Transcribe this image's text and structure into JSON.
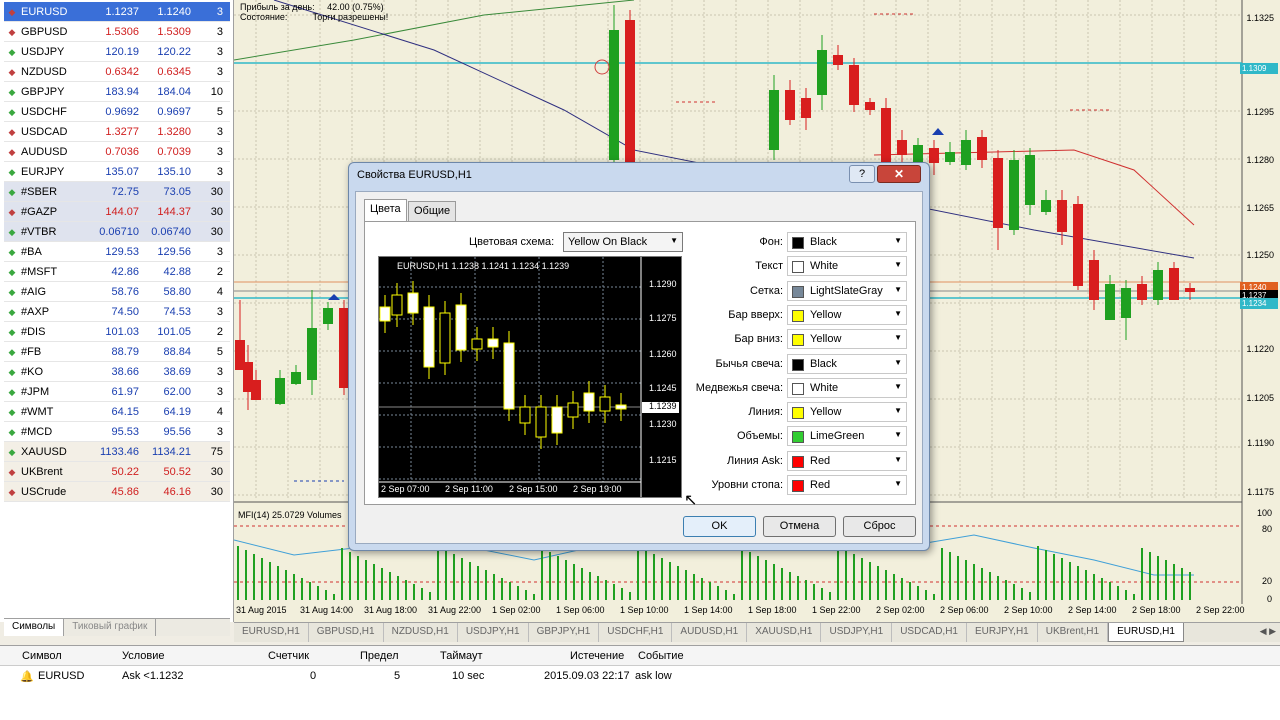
{
  "market_watch": {
    "rows": [
      {
        "symbol": "EURUSD",
        "bid": "1.1237",
        "ask": "1.1240",
        "spread": "3",
        "dir": "down",
        "style": "sel"
      },
      {
        "symbol": "GBPUSD",
        "bid": "1.5306",
        "ask": "1.5309",
        "spread": "3",
        "dir": "down",
        "style": ""
      },
      {
        "symbol": "USDJPY",
        "bid": "120.19",
        "ask": "120.22",
        "spread": "3",
        "dir": "up",
        "style": ""
      },
      {
        "symbol": "NZDUSD",
        "bid": "0.6342",
        "ask": "0.6345",
        "spread": "3",
        "dir": "down",
        "style": ""
      },
      {
        "symbol": "GBPJPY",
        "bid": "183.94",
        "ask": "184.04",
        "spread": "10",
        "dir": "up",
        "style": ""
      },
      {
        "symbol": "USDCHF",
        "bid": "0.9692",
        "ask": "0.9697",
        "spread": "5",
        "dir": "up",
        "style": ""
      },
      {
        "symbol": "USDCAD",
        "bid": "1.3277",
        "ask": "1.3280",
        "spread": "3",
        "dir": "down",
        "style": ""
      },
      {
        "symbol": "AUDUSD",
        "bid": "0.7036",
        "ask": "0.7039",
        "spread": "3",
        "dir": "down",
        "style": ""
      },
      {
        "symbol": "EURJPY",
        "bid": "135.07",
        "ask": "135.10",
        "spread": "3",
        "dir": "up",
        "style": ""
      },
      {
        "symbol": "#SBER",
        "bid": "72.75",
        "ask": "73.05",
        "spread": "30",
        "dir": "up",
        "style": "hl"
      },
      {
        "symbol": "#GAZP",
        "bid": "144.07",
        "ask": "144.37",
        "spread": "30",
        "dir": "down",
        "style": "hl"
      },
      {
        "symbol": "#VTBR",
        "bid": "0.06710",
        "ask": "0.06740",
        "spread": "30",
        "dir": "up",
        "style": "hl"
      },
      {
        "symbol": "#BA",
        "bid": "129.53",
        "ask": "129.56",
        "spread": "3",
        "dir": "up",
        "style": ""
      },
      {
        "symbol": "#MSFT",
        "bid": "42.86",
        "ask": "42.88",
        "spread": "2",
        "dir": "up",
        "style": ""
      },
      {
        "symbol": "#AIG",
        "bid": "58.76",
        "ask": "58.80",
        "spread": "4",
        "dir": "up",
        "style": ""
      },
      {
        "symbol": "#AXP",
        "bid": "74.50",
        "ask": "74.53",
        "spread": "3",
        "dir": "up",
        "style": ""
      },
      {
        "symbol": "#DIS",
        "bid": "101.03",
        "ask": "101.05",
        "spread": "2",
        "dir": "up",
        "style": ""
      },
      {
        "symbol": "#FB",
        "bid": "88.79",
        "ask": "88.84",
        "spread": "5",
        "dir": "up",
        "style": ""
      },
      {
        "symbol": "#KO",
        "bid": "38.66",
        "ask": "38.69",
        "spread": "3",
        "dir": "up",
        "style": ""
      },
      {
        "symbol": "#JPM",
        "bid": "61.97",
        "ask": "62.00",
        "spread": "3",
        "dir": "up",
        "style": ""
      },
      {
        "symbol": "#WMT",
        "bid": "64.15",
        "ask": "64.19",
        "spread": "4",
        "dir": "up",
        "style": ""
      },
      {
        "symbol": "#MCD",
        "bid": "95.53",
        "ask": "95.56",
        "spread": "3",
        "dir": "up",
        "style": ""
      },
      {
        "symbol": "XAUUSD",
        "bid": "1133.46",
        "ask": "1134.21",
        "spread": "75",
        "dir": "up",
        "style": "cfd"
      },
      {
        "symbol": "UKBrent",
        "bid": "50.22",
        "ask": "50.52",
        "spread": "30",
        "dir": "down",
        "style": "cfd"
      },
      {
        "symbol": "USCrude",
        "bid": "45.86",
        "ask": "46.16",
        "spread": "30",
        "dir": "down",
        "style": "cfd"
      }
    ],
    "tabs": [
      "Символы",
      "Тиковый график"
    ]
  },
  "chart": {
    "info_line1": "Прибыль за день:",
    "info_value1": "42.00 (0.75%)",
    "info_line2": "Состояние:",
    "info_value2": "Торги разрешены!",
    "price_labels": [
      "1.1325",
      "1.1309",
      "1.1295",
      "1.1280",
      "1.1265",
      "1.1250",
      "1.1240",
      "1.1237",
      "1.1234",
      "1.1220",
      "1.1205",
      "1.1190",
      "1.1175"
    ],
    "mfi_label": "MFI(14) 25.0729  Volumes",
    "mfi_levels": [
      "100",
      "80",
      "20",
      "0"
    ],
    "time_labels": [
      "31 Aug 2015",
      "31 Aug 14:00",
      "31 Aug 18:00",
      "31 Aug 22:00",
      "1 Sep 02:00",
      "1 Sep 06:00",
      "1 Sep 10:00",
      "1 Sep 14:00",
      "1 Sep 18:00",
      "1 Sep 22:00",
      "2 Sep 02:00",
      "2 Sep 06:00",
      "2 Sep 10:00",
      "2 Sep 14:00",
      "2 Sep 18:00",
      "2 Sep 22:00"
    ],
    "tabs": [
      "EURUSD,H1",
      "GBPUSD,H1",
      "NZDUSD,H1",
      "USDJPY,H1",
      "GBPJPY,H1",
      "USDCHF,H1",
      "AUDUSD,H1",
      "XAUUSD,H1",
      "USDJPY,H1",
      "USDCAD,H1",
      "EURJPY,H1",
      "UKBrent,H1",
      "EURUSD,H1"
    ],
    "active_tab_index": 12
  },
  "alerts": {
    "headers": [
      "Символ",
      "Условие",
      "Счетчик",
      "Предел",
      "Таймаут",
      "Истечение",
      "Событие"
    ],
    "row": [
      "EURUSD",
      "Ask <1.1232",
      "0",
      "5",
      "10 sec",
      "2015.09.03 22:17",
      "ask low"
    ]
  },
  "dialog": {
    "title": "Свойства EURUSD,H1",
    "tabs": [
      "Цвета",
      "Общие"
    ],
    "scheme_label": "Цветовая схема:",
    "scheme_value": "Yellow On Black",
    "preview": {
      "header": "EURUSD,H1  1.1238 1.1241 1.1234 1.1239",
      "y_labels": [
        "1.1290",
        "1.1275",
        "1.1260",
        "1.1245",
        "1.1239",
        "1.1230",
        "1.1215"
      ],
      "x_labels": [
        "2 Sep 07:00",
        "2 Sep 11:00",
        "2 Sep 15:00",
        "2 Sep 19:00"
      ]
    },
    "properties": [
      {
        "label": "Фон:",
        "value": "Black",
        "color": "#000000"
      },
      {
        "label": "Текст",
        "value": "White",
        "color": "#ffffff"
      },
      {
        "label": "Сетка:",
        "value": "LightSlateGray",
        "color": "#778899"
      },
      {
        "label": "Бар вверх:",
        "value": "Yellow",
        "color": "#ffff00"
      },
      {
        "label": "Бар вниз:",
        "value": "Yellow",
        "color": "#ffff00"
      },
      {
        "label": "Бычья свеча:",
        "value": "Black",
        "color": "#000000"
      },
      {
        "label": "Медвежья свеча:",
        "value": "White",
        "color": "#ffffff"
      },
      {
        "label": "Линия:",
        "value": "Yellow",
        "color": "#ffff00"
      },
      {
        "label": "Объемы:",
        "value": "LimeGreen",
        "color": "#32cd32"
      },
      {
        "label": "Линия Ask:",
        "value": "Red",
        "color": "#ff0000"
      },
      {
        "label": "Уровни стопа:",
        "value": "Red",
        "color": "#ff0000"
      }
    ],
    "buttons": {
      "ok": "OK",
      "cancel": "Отмена",
      "reset": "Сброс"
    },
    "help": "?",
    "close": "✕"
  }
}
